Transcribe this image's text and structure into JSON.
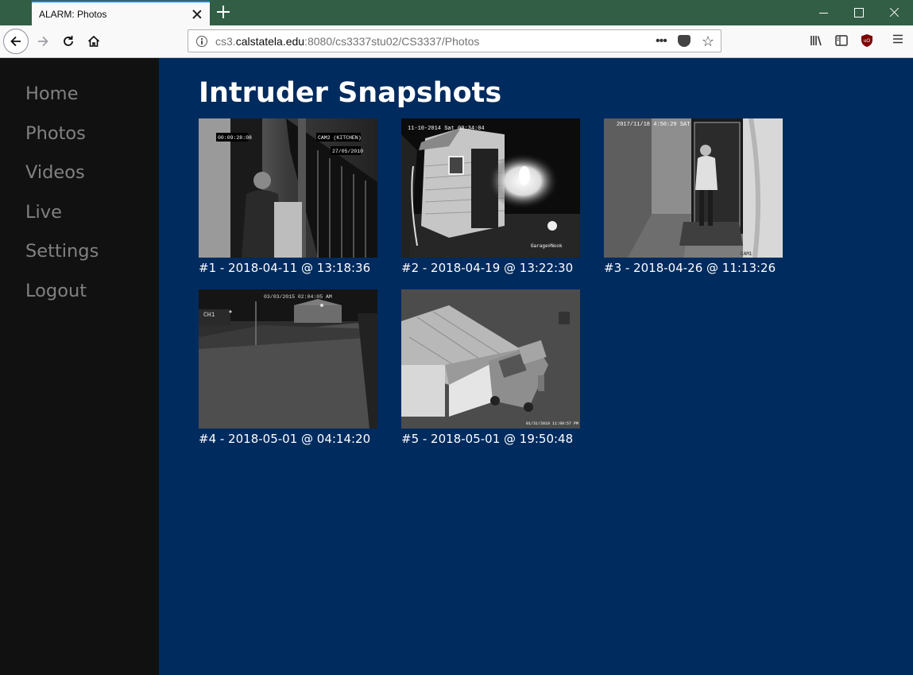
{
  "browser": {
    "tab_title": "ALARM: Photos",
    "url_prefix": "cs3.",
    "url_host": "calstatela.edu",
    "url_path": ":8080/cs3337stu02/CS3337/Photos"
  },
  "sidebar": {
    "items": [
      {
        "label": "Home"
      },
      {
        "label": "Photos"
      },
      {
        "label": "Videos"
      },
      {
        "label": "Live"
      },
      {
        "label": "Settings"
      },
      {
        "label": "Logout"
      }
    ]
  },
  "main": {
    "title": "Intruder Snapshots",
    "snapshots": [
      {
        "caption": "#1 - 2018-04-11 @ 13:18:36",
        "overlay": [
          "00:09:28:08",
          "CAM2 (KITCHEN)",
          "27/05/2010"
        ]
      },
      {
        "caption": "#2 - 2018-04-19 @ 13:22:30",
        "overlay": [
          "11-10-2014 Sat 00:34:04",
          "Garage#Nook"
        ]
      },
      {
        "caption": "#3 - 2018-04-26 @ 11:13:26",
        "overlay": [
          "2017/11/18 4:50:29 SAT",
          "CAM1"
        ]
      },
      {
        "caption": "#4 - 2018-05-01 @ 04:14:20",
        "overlay": [
          "03/03/2015 02:04:05 AM",
          "CH1"
        ]
      },
      {
        "caption": "#5 - 2018-05-01 @ 19:50:48",
        "overlay": [
          "01/31/2018 11:09:57 PM"
        ]
      }
    ]
  },
  "colors": {
    "main_bg": "#002b5e",
    "sidebar_bg": "#111111",
    "sidebar_text": "#818181",
    "tabbar_bg": "#325e45"
  }
}
